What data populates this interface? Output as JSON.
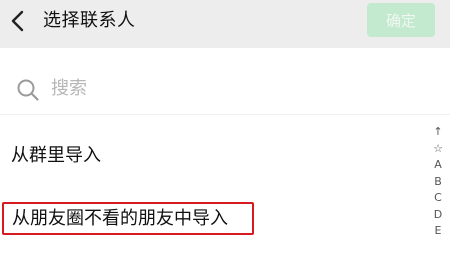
{
  "header": {
    "title": "选择联系人",
    "confirm_label": "确定"
  },
  "search": {
    "placeholder": "搜索"
  },
  "list": {
    "items": [
      {
        "label": "从群里导入"
      },
      {
        "label": "从朋友圈不看的朋友中导入"
      }
    ]
  },
  "index_bar": {
    "letters": [
      "↑",
      "☆",
      "A",
      "B",
      "C",
      "D",
      "E"
    ]
  },
  "colors": {
    "header_bg": "#ededed",
    "confirm_bg": "#c3e9cf",
    "highlight_border": "#d71920"
  },
  "icons": {
    "back": "chevron-left-icon",
    "search": "search-icon"
  }
}
